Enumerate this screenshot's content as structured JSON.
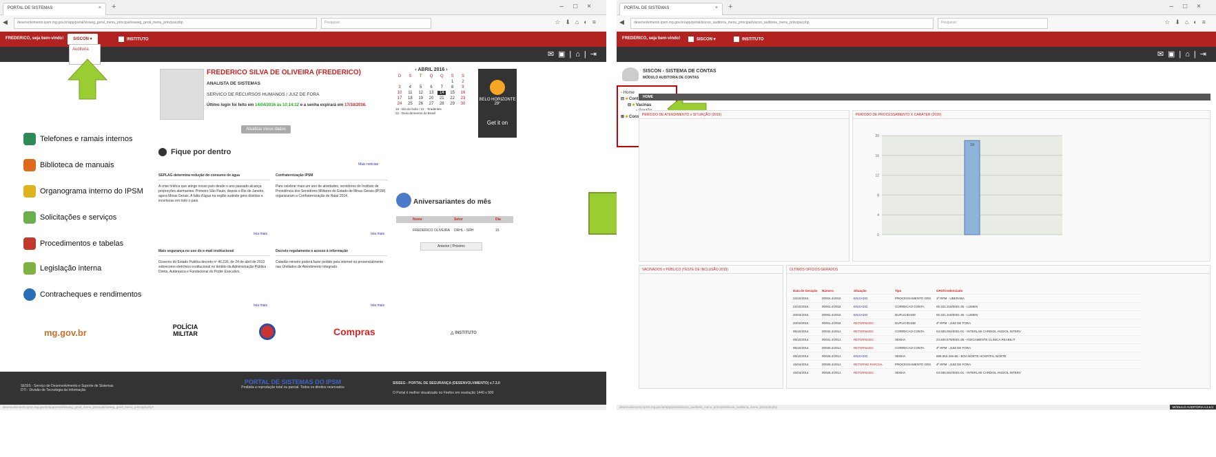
{
  "left": {
    "tab_title": "PORTAL DE SISTEMAS",
    "url": "desenvolvimento.ipsm.mg.gov.br/app/portal/sisweg_geral_menu_principal/sisweg_geral_menu_principal.php",
    "search_placeholder": "Pesquisar",
    "greeting": "FREDERICO, seja bem-vindo!",
    "menu_siscon": "SISCON",
    "menu_instituto": "INSTITUTO",
    "dropdown_item": "Auditoria",
    "user_name": "FREDERICO SILVA DE OLIVEIRA (FREDERICO)",
    "user_role": "ANALISTA DE SISTEMAS",
    "user_dept": "SERVICO DE RECURSOS HUMANOS / JUIZ DE FORA",
    "last_login_prefix": "Último login foi feito em",
    "last_login_date": "14/04/2016 às 10:14:12",
    "last_login_mid": "e a senha expirará em",
    "last_login_exp": "17/10/2016.",
    "btn_update": "Atualizar meus dados",
    "calendar": {
      "month": "ABRIL 2016",
      "weekdays": [
        "D",
        "S",
        "T",
        "Q",
        "Q",
        "S",
        "S"
      ],
      "weeks": [
        [
          "",
          "",
          "",
          "",
          "",
          "1",
          "2"
        ],
        [
          "3",
          "4",
          "5",
          "6",
          "7",
          "8",
          "9"
        ],
        [
          "10",
          "11",
          "12",
          "13",
          "14",
          "15",
          "16"
        ],
        [
          "17",
          "18",
          "19",
          "20",
          "21",
          "22",
          "23"
        ],
        [
          "24",
          "25",
          "26",
          "27",
          "28",
          "29",
          "30"
        ]
      ],
      "legend1": "19 - Dia do Índio / 21 - Tiradentes",
      "legend2": "22 - Descobrimento do Brasil"
    },
    "weather_city": "BELO HORIZONTE",
    "weather_temp": "29°",
    "weather_cta": "Get it on",
    "links": [
      "Telefones e ramais internos",
      "Biblioteca de manuais",
      "Organograma interno do IPSM",
      "Solicitações e serviços",
      "Procedimentos e tabelas",
      "Legislação interna",
      "Contracheques e rendimentos"
    ],
    "news_title": "Fique por dentro",
    "news_more_link": "Mais notícias",
    "news": [
      {
        "title": "SEPLAG determina redução do consumo de água",
        "body": "A crise hídrica que atinge nosso país desde o ano passado alcança proporções alarmantes. Primeiro São Paulo, depois o Rio de Janeiro, agora Minas Gerais. A falta d'água na região sudeste gera dúvidas e incertezas em todo o país.",
        "more": "leia mais"
      },
      {
        "title": "Confraternização IPSM",
        "body": "Para celebrar mais um ano de atividades, servidores do Instituto de Previdência dos Servidores Militares do Estado de Minas Gerais (IPSM) organizaram a Confraternização de Natal 2014.",
        "more": "leia mais"
      },
      {
        "title": "Mais segurança no uso do e-mail institucional",
        "body": "Governo do Estado Publica decreto nº 46.226, de 24 de abril de 2013 sobrecomo eletrônico institucional no âmbito da Administração Pública Direta, Autárquica e Fundacional do Poder Executivo.",
        "more": "leia mais"
      },
      {
        "title": "Decreto regulamenta o acesso à informação",
        "body": "Cidadão mineiro poderá fazer pedido pela internet ou presencialmente nas Unidades de Atendimento Integrado.",
        "more": "leia mais"
      }
    ],
    "birthday_title": "Aniversariantes do mês",
    "birthday_headers": [
      "Nome",
      "Setor",
      "Dia"
    ],
    "birthday_row": [
      "FREDERICO OLIVEIRA",
      "DRHL - SRH",
      "15"
    ],
    "pager_prev": "Anterior",
    "pager_next": "Próximo",
    "logos": [
      "mg.gov.br",
      "POLÍCIA MILITAR",
      "CBMMG",
      "Compras",
      "INSTITUTO"
    ],
    "footer_left1": "SESIS - Serviço de Desenvolvimento e Suporte de Sistemas",
    "footer_left2": "DTI - Divisão de Tecnologia da Informação",
    "footer_center": "PORTAL DE SISTEMAS DO IPSM",
    "footer_center2": "Proibida a reprodução total ou parcial. Todos os direitos reservados",
    "footer_right": "SISSEG - PORTAL DE SEGURANÇA (DESENVOLVIMENTO) v.7.3.0",
    "footer_right2": "O Portal é melhor visualizado no Firefox em resolução 1440 x 900",
    "status": "desenvolvimento.ipsm.mg.gov.br/app/portal/sisweg_geral_menu_principal/sisweg_geral_menu_principal.php#"
  },
  "right": {
    "tab_title": "PORTAL DE SISTEMAS",
    "url": "desenvolvimento.ipsm.mg.gov.br/app/portal/siscon_auditoria_menu_principal/siscon_auditoria_menu_principal.php",
    "search_placeholder": "Pesquisar",
    "greeting": "FREDERICO, seja bem-vindo!",
    "menu_siscon": "SISCON",
    "menu_instituto": "INSTITUTO",
    "sys_title": "SISCON - SISTEMA DE CONTAS",
    "sys_sub": "MÓDULO AUDITORIA DE CONTAS",
    "tree": [
      "Home",
      "Controle",
      "Vacinas",
      "Gestão",
      "Consultas"
    ],
    "home_tab": "HOME",
    "panel1": "PERÍODO DE ATENDIMENTO x SITUAÇÃO (2016)",
    "panel2": "PERÍODO DE PROCESSAMENTO X CARÁTER (2016)",
    "panel3": "VACINADOS x PÚBLICO (TESTE DE INCLUSÃO 2015)",
    "panel4": "ÚLTIMOS OFÍCIOS GERADOS",
    "offices_headers": [
      "Data de Geração",
      "Número",
      "Situação",
      "Tipo",
      "GRS/Credenciado"
    ],
    "offices": [
      [
        "22/10/2015",
        "00004.4/2016",
        "ENVIADO",
        "PROCESSAMENTO GRS",
        "1ª RPM - UBERABA"
      ],
      [
        "22/10/2015",
        "00003.4/2016",
        "ENVIADO",
        "CORRECAO CONTA",
        "00.221.319/0001-45 - LUMEN"
      ],
      [
        "20/03/2015",
        "00002.4/2016",
        "ENVIADO",
        "DUPLICIDADE",
        "00.221.319/0001-45 - LUMEN"
      ],
      [
        "20/02/2015",
        "00001.4/2016",
        "RETORNADO",
        "DUPLICIDADE",
        "4ª RPM - JUIZ DE FORA"
      ],
      [
        "05/10/2014",
        "00032.4/2014",
        "RETORNADO",
        "CORRECAO CONTA",
        "04.505.002/0001-01 - INTERLAB CARDIOL ANGIOL INTERV"
      ],
      [
        "05/10/2014",
        "00031.4/2014",
        "RETORNADO",
        "SENHA",
        "23.600.579/0001-35 - FISICAMENTE CLINICA REABILIT"
      ],
      [
        "05/10/2014",
        "00030.4/2014",
        "RETORNADO",
        "CORRECAO CONTA",
        "4ª RPM - JUIZ DE FORA"
      ],
      [
        "05/10/2014",
        "00029.4/2014",
        "ENVIADO",
        "SENHA",
        "888.063.346-65 - BOA NORTE HOSPITAL NORTE"
      ],
      [
        "15/04/2014",
        "00028.4/2014",
        "RETORNO PARCIAL",
        "PROCESSAMENTO GRS",
        "4ª RPM - JUIZ DE FORA"
      ],
      [
        "15/04/2014",
        "00026.4/2014",
        "RETORNADO",
        "SENHA",
        "04.505.002/0001-01 - INTERLAB CARDIOL ANGIOL INTERV"
      ]
    ],
    "status": "desenvolvimento.ipsm.mg.gov.br/app/portal/siscon_auditoria_menu_principal/siscon_auditoria_menu_principal.php",
    "status_right": "MÓDULO AUDITORIA v.3.6.0"
  },
  "chart_data": {
    "type": "bar",
    "title": "PERÍODO DE PROCESSAMENTO X CARÁTER (2016)",
    "categories": [
      ""
    ],
    "values": [
      19
    ],
    "ylim": [
      0,
      20
    ],
    "yticks": [
      "20",
      "16",
      "12",
      "8",
      "4",
      "0"
    ]
  },
  "colors": {
    "brand_red": "#b12220",
    "dark_bar": "#333333",
    "arrow_green": "#9acd32"
  }
}
